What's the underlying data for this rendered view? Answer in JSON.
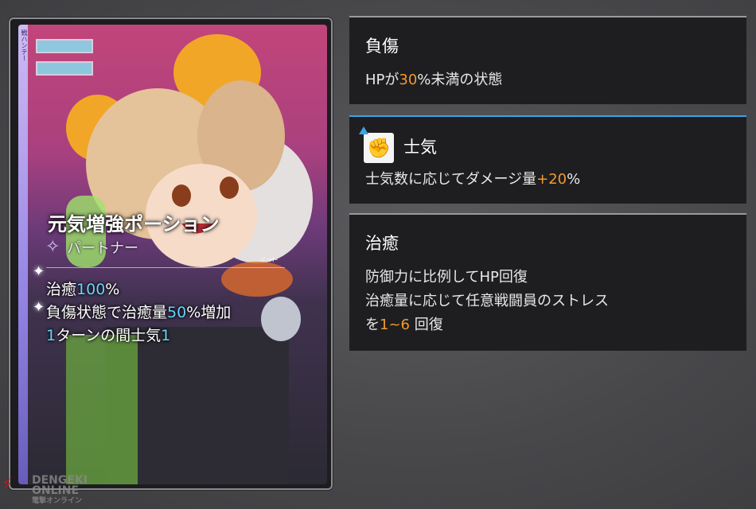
{
  "card": {
    "strip_text": "戦ハンテー",
    "name": "元気増強ポーション",
    "role": "パートナー",
    "role_tag": "ﾊﾟｰﾄﾅｰ",
    "desc": {
      "line1": {
        "pre": "治癒",
        "num": "100",
        "post": "%"
      },
      "line2": {
        "pre": "負傷状態で治癒量",
        "num": "50",
        "post": "%増加"
      },
      "line3": {
        "num1": "1",
        "mid": "ターンの間士気",
        "num2": "1"
      }
    }
  },
  "panels": [
    {
      "title": "負傷",
      "body": {
        "pre": "HPが",
        "num": "30",
        "post": "%未満の状態"
      }
    },
    {
      "title": "士気",
      "icon": "raised-fist-icon",
      "body": {
        "pre": "士気数に応じてダメージ量",
        "num": "+20",
        "post": "%"
      }
    },
    {
      "title": "治癒",
      "body": {
        "line1": "防御力に比例してHP回復",
        "line2": "治癒量に応じて任意戦闘員のストレス",
        "line3_pre": "を",
        "line3_num": "1~6",
        "line3_post": " 回復"
      }
    }
  ],
  "watermark": {
    "line1": "DENGEKI",
    "line2": "ONLINE",
    "line3": "電撃オンライン"
  },
  "colors": {
    "accent_blue": "#3aa4e6",
    "num_orange": "#f39a2e",
    "num_cyan": "#66d6ff"
  }
}
